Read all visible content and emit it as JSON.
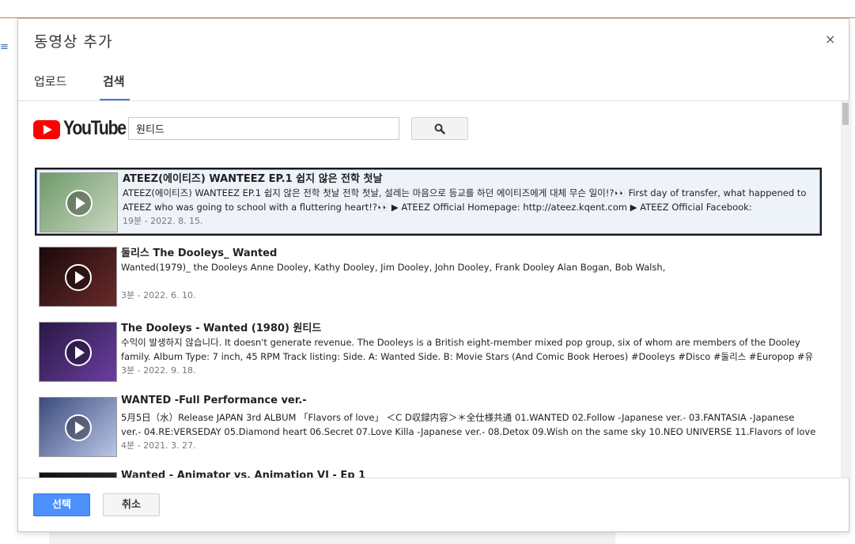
{
  "dialog": {
    "title": "동영상 추가",
    "close_label": "×",
    "tabs": [
      {
        "label": "업로드",
        "active": false
      },
      {
        "label": "검색",
        "active": true
      }
    ]
  },
  "youtube": {
    "logo_text": "YouTube"
  },
  "search": {
    "value": "원티드",
    "button_icon": "search-icon"
  },
  "results": [
    {
      "title": "ATEEZ(에이티즈) WANTEEZ EP.1 쉽지 않은 전학 첫날",
      "description": "ATEEZ(에이티즈) WANTEEZ EP.1 쉽지 않은 전학 첫날 전학 첫날, 설레는 마음으로 등교를 하던 에이티즈에게 대체 무슨 일이!?👀 First day of transfer, what happened to ATEEZ who was going to school with a fluttering heart!?👀 ▶ ATEEZ Official Homepage: http://ateez.kqent.com ▶ ATEEZ Official Facebook:",
      "meta": "19분 - 2022. 8. 15.",
      "selected": true,
      "thumb_colors": [
        "#6f9a6a",
        "#c9d7c2"
      ]
    },
    {
      "title": "둘리스 The Dooleys_ Wanted",
      "description": "Wanted(1979)_ the Dooleys Anne Dooley, Kathy Dooley, Jim Dooley, John Dooley, Frank Dooley Alan Bogan, Bob Walsh,",
      "meta": "3분 - 2022. 6. 10.",
      "selected": false,
      "thumb_colors": [
        "#1a0a0c",
        "#6b2a2a"
      ]
    },
    {
      "title": "The Dooleys - Wanted (1980) 원티드",
      "description": "수익이 발생하지 않습니다. It doesn't generate revenue. The Dooleys is a British eight-member mixed pop group, six of whom are members of the Dooley family. Album Type: 7 inch, 45 RPM Track listing: Side. A: Wanted Side. B: Movie Stars (And Comic Book Heroes) #Dooleys #Disco #둘리스 #Europop #유",
      "meta": "3분 - 2022. 9. 18.",
      "selected": false,
      "thumb_colors": [
        "#2a1845",
        "#6a3fa0"
      ]
    },
    {
      "title": "WANTED -Full Performance ver.-",
      "description": "5月5日（水）Release JAPAN 3rd ALBUM 「Flavors of love」 ＜C D収録内容＞＊全仕様共通 01.WANTED 02.Follow -Japanese ver.- 03.FANTASIA -Japanese ver.- 04.RE:VERSEDAY 05.Diamond heart 06.Secret 07.Love Killa -Japanese ver.- 08.Detox 09.Wish on the same sky 10.NEO UNIVERSE 11.Flavors of love",
      "meta": "4분 - 2021. 3. 27.",
      "selected": false,
      "thumb_colors": [
        "#3b4a7a",
        "#b9c6e8"
      ]
    },
    {
      "title": "Wanted - Animator vs. Animation VI - Ep 1",
      "description": "",
      "meta": "",
      "selected": false,
      "thumb_colors": [
        "#111111",
        "#333333"
      ]
    }
  ],
  "footer": {
    "select_label": "선택",
    "cancel_label": "취소"
  },
  "colors": {
    "accent": "#4d90fe",
    "tab_underline": "#3a7ae8",
    "youtube_red": "#ff0000"
  }
}
